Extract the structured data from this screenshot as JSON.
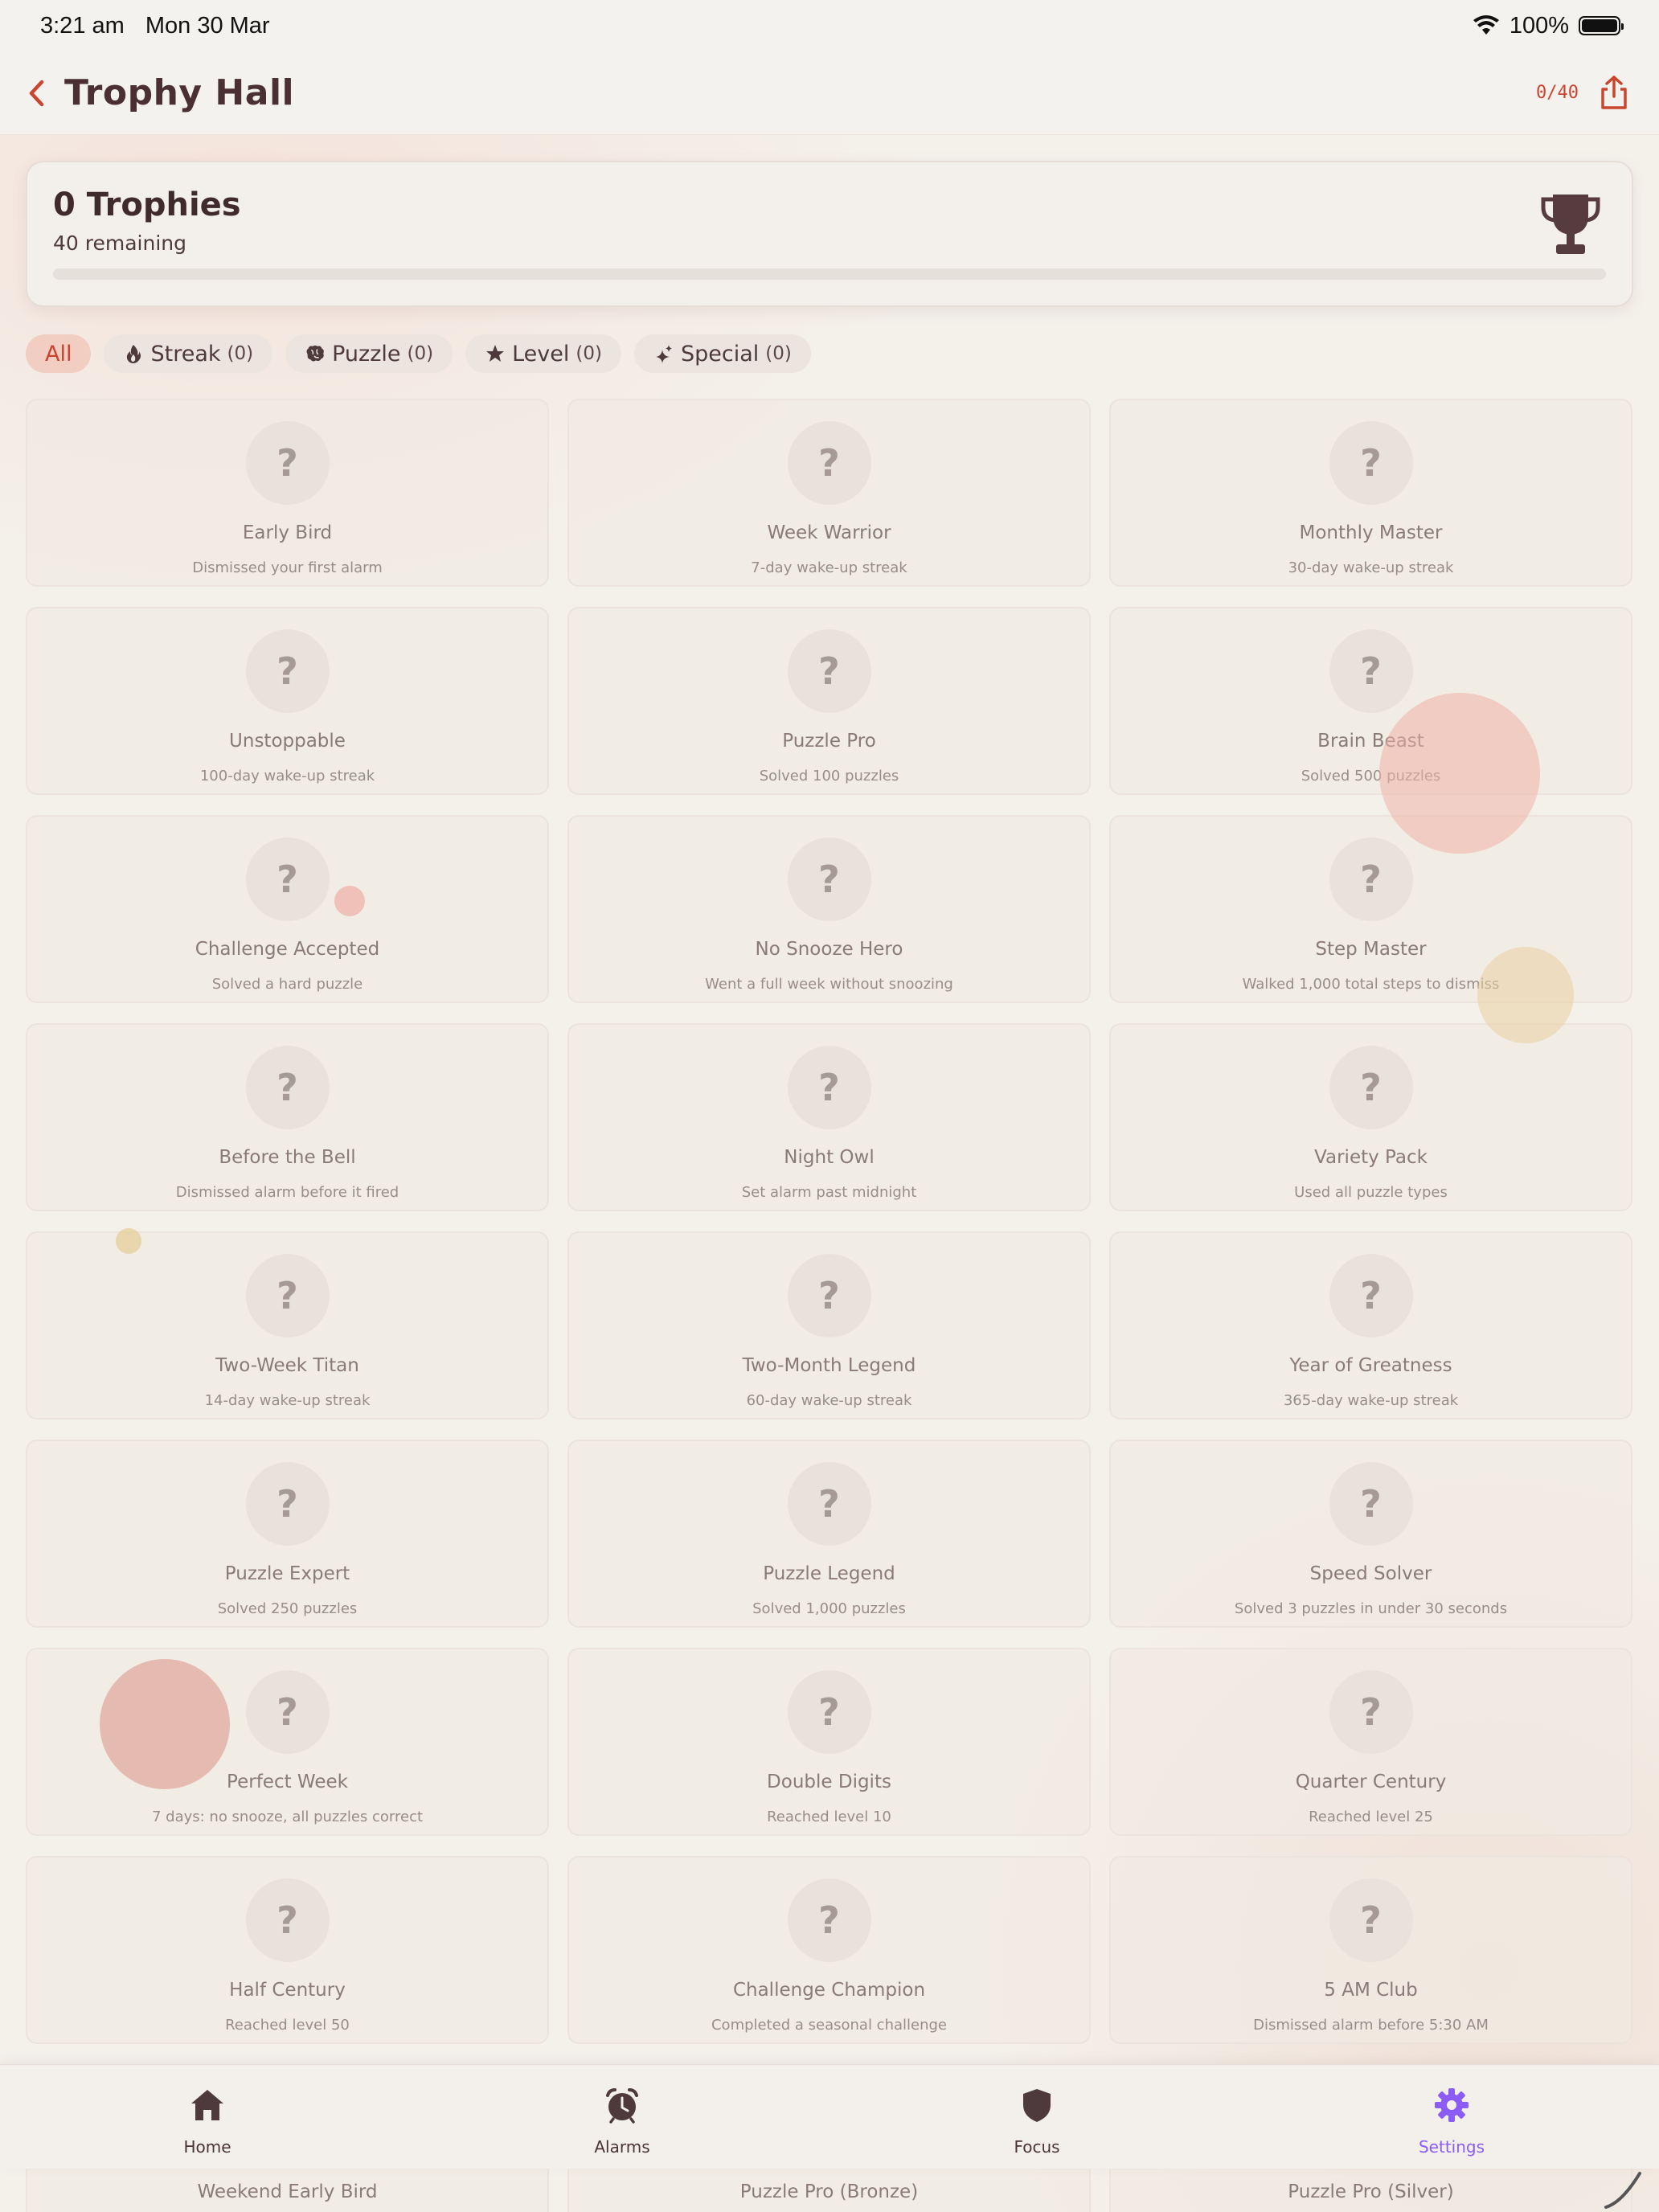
{
  "status_bar": {
    "time": "3:21 am",
    "date": "Mon 30 Mar",
    "battery": "100%"
  },
  "nav": {
    "title": "Trophy Hall",
    "count": "0/40"
  },
  "summary": {
    "title": "0 Trophies",
    "remaining": "40 remaining",
    "progress": 0
  },
  "filters": [
    {
      "label": "All",
      "count": "",
      "icon": "none",
      "active": true
    },
    {
      "label": "Streak",
      "count": "(0)",
      "icon": "flame-icon",
      "active": false
    },
    {
      "label": "Puzzle",
      "count": "(0)",
      "icon": "brain-icon",
      "active": false
    },
    {
      "label": "Level",
      "count": "(0)",
      "icon": "star-icon",
      "active": false
    },
    {
      "label": "Special",
      "count": "(0)",
      "icon": "sparkle-icon",
      "active": false
    }
  ],
  "locked_symbol": "?",
  "trophies": [
    {
      "name": "Early Bird",
      "desc": "Dismissed your first alarm"
    },
    {
      "name": "Week Warrior",
      "desc": "7-day wake-up streak"
    },
    {
      "name": "Monthly Master",
      "desc": "30-day wake-up streak"
    },
    {
      "name": "Unstoppable",
      "desc": "100-day wake-up streak"
    },
    {
      "name": "Puzzle Pro",
      "desc": "Solved 100 puzzles"
    },
    {
      "name": "Brain Beast",
      "desc": "Solved 500 puzzles"
    },
    {
      "name": "Challenge Accepted",
      "desc": "Solved a hard puzzle"
    },
    {
      "name": "No Snooze Hero",
      "desc": "Went a full week without snoozing"
    },
    {
      "name": "Step Master",
      "desc": "Walked 1,000 total steps to dismiss"
    },
    {
      "name": "Before the Bell",
      "desc": "Dismissed alarm before it fired"
    },
    {
      "name": "Night Owl",
      "desc": "Set alarm past midnight"
    },
    {
      "name": "Variety Pack",
      "desc": "Used all puzzle types"
    },
    {
      "name": "Two-Week Titan",
      "desc": "14-day wake-up streak"
    },
    {
      "name": "Two-Month Legend",
      "desc": "60-day wake-up streak"
    },
    {
      "name": "Year of Greatness",
      "desc": "365-day wake-up streak"
    },
    {
      "name": "Puzzle Expert",
      "desc": "Solved 250 puzzles"
    },
    {
      "name": "Puzzle Legend",
      "desc": "Solved 1,000 puzzles"
    },
    {
      "name": "Speed Solver",
      "desc": "Solved 3 puzzles in under 30 seconds"
    },
    {
      "name": "Perfect Week",
      "desc": "7 days: no snooze, all puzzles correct"
    },
    {
      "name": "Double Digits",
      "desc": "Reached level 10"
    },
    {
      "name": "Quarter Century",
      "desc": "Reached level 25"
    },
    {
      "name": "Half Century",
      "desc": "Reached level 50"
    },
    {
      "name": "Challenge Champion",
      "desc": "Completed a seasonal challenge"
    },
    {
      "name": "5 AM Club",
      "desc": "Dismissed alarm before 5:30 AM"
    }
  ],
  "partial_row": [
    "Weekend Early Bird",
    "Puzzle Pro (Bronze)",
    "Puzzle Pro (Silver)"
  ],
  "tabs": [
    {
      "label": "Home",
      "icon": "home-icon",
      "active": false
    },
    {
      "label": "Alarms",
      "icon": "alarm-clock-icon",
      "active": false
    },
    {
      "label": "Focus",
      "icon": "shield-icon",
      "active": false
    },
    {
      "label": "Settings",
      "icon": "gear-icon",
      "active": true
    }
  ],
  "colors": {
    "accent": "#c9452e",
    "title": "#4a2f33",
    "active_tab": "#8b5cf6",
    "chip_active_bg": "#f1cdc2",
    "bubble_pink": "#f0b8ae",
    "bubble_gold": "#ead6ab"
  }
}
